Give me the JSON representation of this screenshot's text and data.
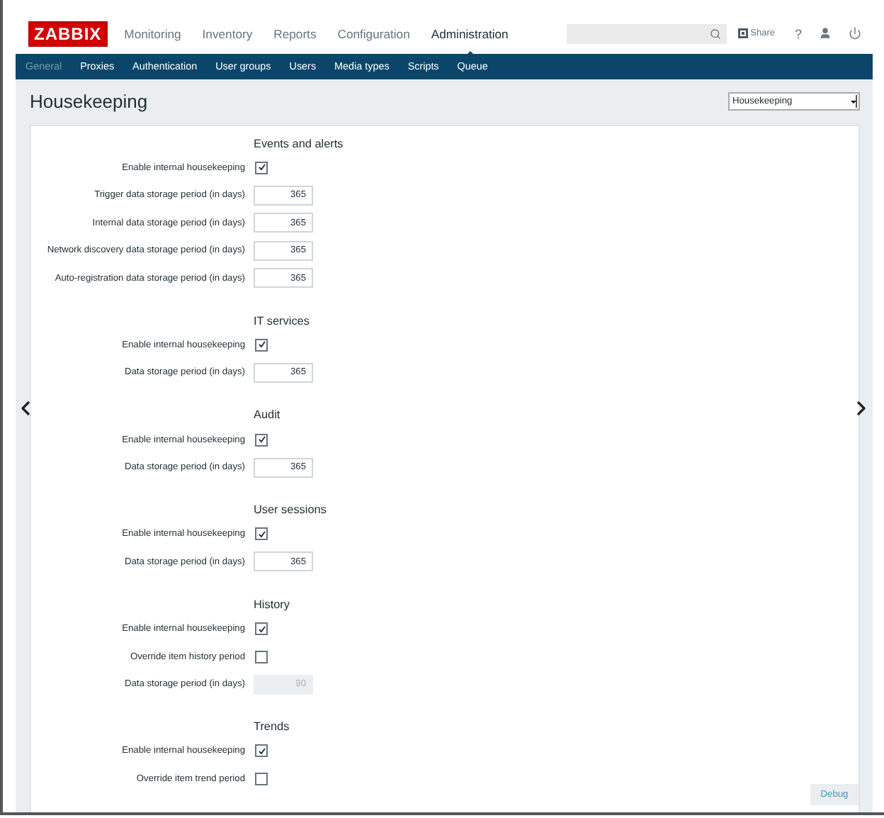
{
  "header": {
    "logo": "ZABBIX",
    "menu": [
      {
        "label": "Monitoring",
        "selected": false
      },
      {
        "label": "Inventory",
        "selected": false
      },
      {
        "label": "Reports",
        "selected": false
      },
      {
        "label": "Configuration",
        "selected": false
      },
      {
        "label": "Administration",
        "selected": true
      }
    ],
    "share": "Share",
    "help": "?"
  },
  "submenu": [
    {
      "label": "General",
      "selected": true
    },
    {
      "label": "Proxies",
      "selected": false
    },
    {
      "label": "Authentication",
      "selected": false
    },
    {
      "label": "User groups",
      "selected": false
    },
    {
      "label": "Users",
      "selected": false
    },
    {
      "label": "Media types",
      "selected": false
    },
    {
      "label": "Scripts",
      "selected": false
    },
    {
      "label": "Queue",
      "selected": false
    }
  ],
  "page": {
    "title": "Housekeeping",
    "selector": "Housekeeping"
  },
  "sections": [
    {
      "title": "Events and alerts",
      "rows": [
        {
          "kind": "checkbox",
          "label": "Enable internal housekeeping",
          "checked": true
        },
        {
          "kind": "input",
          "label": "Trigger data storage period (in days)",
          "value": "365",
          "disabled": false
        },
        {
          "kind": "input",
          "label": "Internal data storage period (in days)",
          "value": "365",
          "disabled": false
        },
        {
          "kind": "input",
          "label": "Network discovery data storage period (in days)",
          "value": "365",
          "disabled": false
        },
        {
          "kind": "input",
          "label": "Auto-registration data storage period (in days)",
          "value": "365",
          "disabled": false
        }
      ]
    },
    {
      "title": "IT services",
      "rows": [
        {
          "kind": "checkbox",
          "label": "Enable internal housekeeping",
          "checked": true
        },
        {
          "kind": "input",
          "label": "Data storage period (in days)",
          "value": "365",
          "disabled": false
        }
      ]
    },
    {
      "title": "Audit",
      "rows": [
        {
          "kind": "checkbox",
          "label": "Enable internal housekeeping",
          "checked": true
        },
        {
          "kind": "input",
          "label": "Data storage period (in days)",
          "value": "365",
          "disabled": false
        }
      ]
    },
    {
      "title": "User sessions",
      "rows": [
        {
          "kind": "checkbox",
          "label": "Enable internal housekeeping",
          "checked": true
        },
        {
          "kind": "input",
          "label": "Data storage period (in days)",
          "value": "365",
          "disabled": false
        }
      ]
    },
    {
      "title": "History",
      "rows": [
        {
          "kind": "checkbox",
          "label": "Enable internal housekeeping",
          "checked": true
        },
        {
          "kind": "checkbox",
          "label": "Override item history period",
          "checked": false
        },
        {
          "kind": "input",
          "label": "Data storage period (in days)",
          "value": "90",
          "disabled": true
        }
      ]
    },
    {
      "title": "Trends",
      "rows": [
        {
          "kind": "checkbox",
          "label": "Enable internal housekeeping",
          "checked": true
        },
        {
          "kind": "checkbox",
          "label": "Override item trend period",
          "checked": false
        }
      ]
    }
  ],
  "debug": "Debug"
}
